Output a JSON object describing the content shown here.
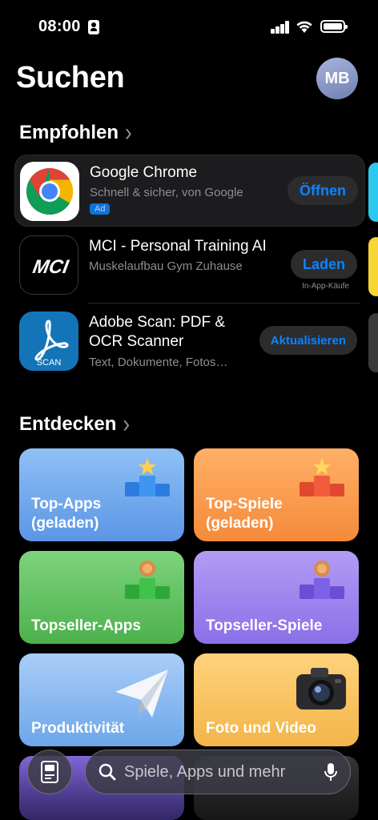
{
  "status": {
    "time": "08:00"
  },
  "header": {
    "title": "Suchen",
    "avatar_initials": "MB"
  },
  "recommended": {
    "title": "Empfohlen",
    "apps": [
      {
        "name": "Google Chrome",
        "subtitle": "Schnell & sicher, von Google",
        "badge": "Ad",
        "action": "Öffnen",
        "note": ""
      },
      {
        "name": "MCI - Personal Training AI",
        "subtitle": "Muskelaufbau Gym Zuhause",
        "badge": "",
        "action": "Laden",
        "note": "In-App-Käufe"
      },
      {
        "name_line1": "Adobe Scan: PDF &",
        "name_line2": "OCR Scanner",
        "subtitle": "Text, Dokumente, Fotos…",
        "badge": "",
        "action": "Aktualisieren",
        "note": ""
      }
    ]
  },
  "discover": {
    "title": "Entdecken",
    "tiles": [
      {
        "line1": "Top-Apps",
        "line2": "(geladen)",
        "color_top": "#8fc0f5",
        "color_bottom": "#5b96e6"
      },
      {
        "line1": "Top-Spiele",
        "line2": "(geladen)",
        "color_top": "#ffb066",
        "color_bottom": "#f58a3a"
      },
      {
        "line1": "Topseller-Apps",
        "line2": "",
        "color_top": "#7ed37c",
        "color_bottom": "#4cb14d"
      },
      {
        "line1": "Topseller-Spiele",
        "line2": "",
        "color_top": "#b39cf5",
        "color_bottom": "#8a6fe8"
      },
      {
        "line1": "Produktivität",
        "line2": "",
        "color_top": "#a9cdf7",
        "color_bottom": "#6da6ea"
      },
      {
        "line1": "Foto und Video",
        "line2": "",
        "color_top": "#ffd27a",
        "color_bottom": "#f2b54a"
      }
    ]
  },
  "search": {
    "placeholder": "Spiele, Apps und mehr"
  },
  "colors": {
    "accent": "#0a84ff",
    "background": "#000000",
    "card": "#1c1c1e"
  },
  "icons": [
    "search-icon",
    "microphone-icon",
    "today-icon",
    "chevron-right-icon"
  ]
}
